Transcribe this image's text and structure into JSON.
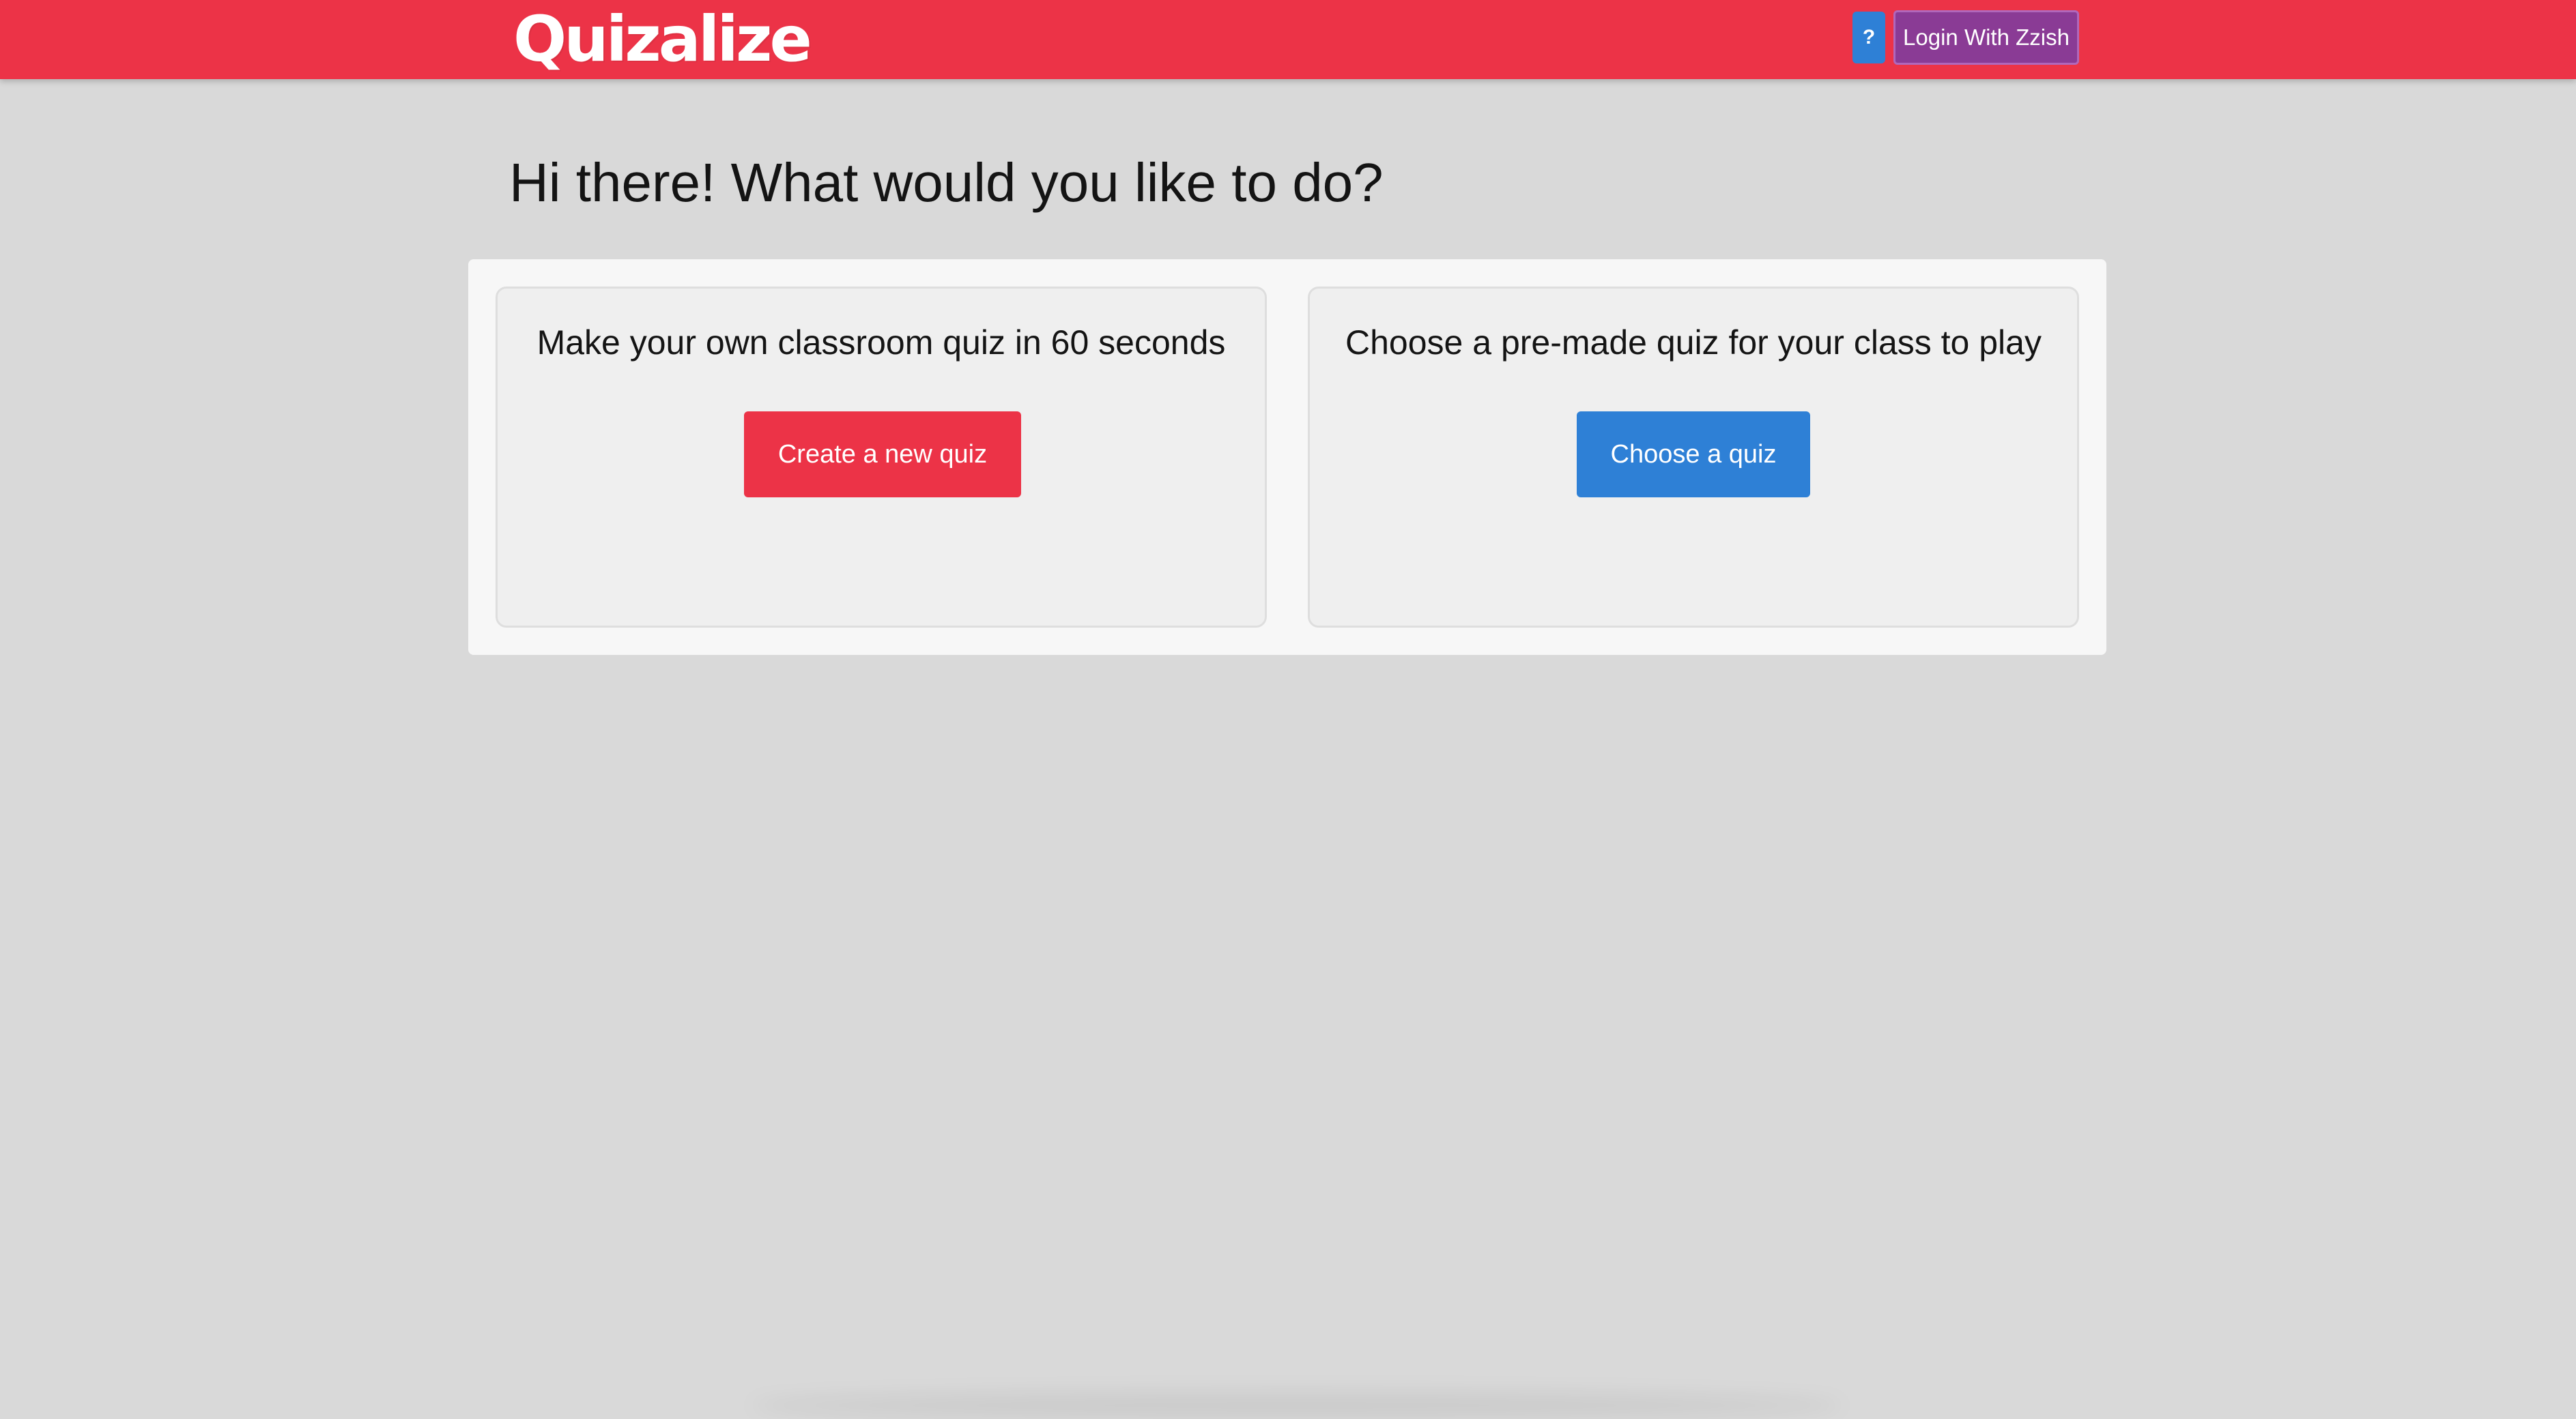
{
  "header": {
    "logo_text": "Quizalize",
    "help_label": "?",
    "login_label": "Login With Zzish"
  },
  "main": {
    "title": "Hi there! What would you like to do?",
    "cards": [
      {
        "text": "Make your own classroom quiz in 60 seconds",
        "button_label": "Create a new quiz"
      },
      {
        "text": "Choose a pre-made quiz for your class to play",
        "button_label": "Choose a quiz"
      }
    ]
  },
  "colors": {
    "brand_red": "#ec3347",
    "accent_blue": "#2e80d6",
    "login_purple": "#8a3b95",
    "page_background": "#d9d9d9"
  },
  "icons": {
    "help": "question-mark-icon"
  }
}
